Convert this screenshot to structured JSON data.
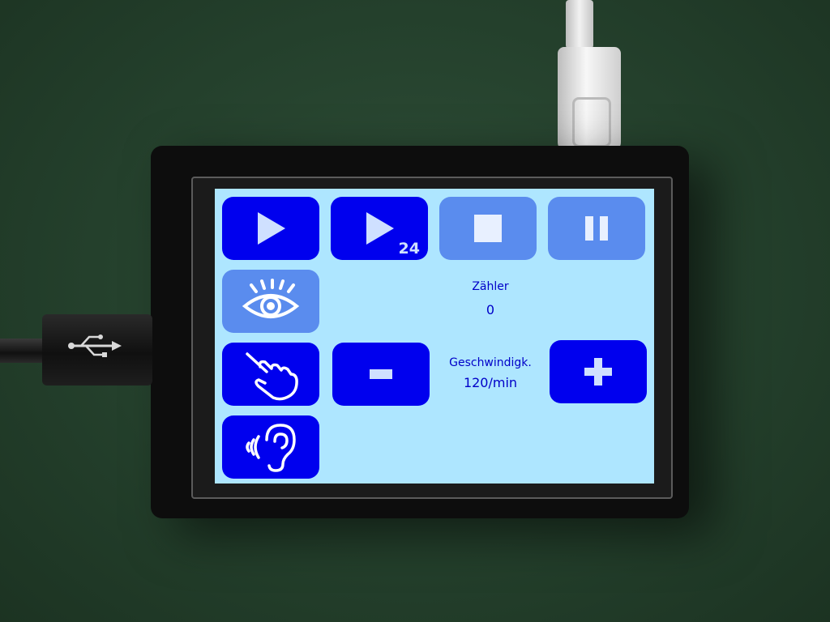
{
  "screen": {
    "buttons": {
      "play": {
        "icon": "play-icon"
      },
      "play24": {
        "icon": "play-icon",
        "badge": "24"
      },
      "stop": {
        "icon": "stop-icon"
      },
      "pause": {
        "icon": "pause-icon"
      },
      "eye": {
        "icon": "eye-icon"
      },
      "hand": {
        "icon": "pointing-hand-icon"
      },
      "ear": {
        "icon": "ear-sound-icon"
      },
      "minus": {
        "icon": "minus-icon"
      },
      "plus": {
        "icon": "plus-icon"
      }
    },
    "counter": {
      "label": "Zähler",
      "value": "0"
    },
    "speed": {
      "label": "Geschwindigk.",
      "value": "120/min"
    }
  },
  "colors": {
    "screen_bg": "#aee6ff",
    "button_active": "#0000ee",
    "button_dim": "#5a8cee",
    "text": "#0000c8"
  },
  "hardware": {
    "usb_port_icon": "usb-icon"
  }
}
